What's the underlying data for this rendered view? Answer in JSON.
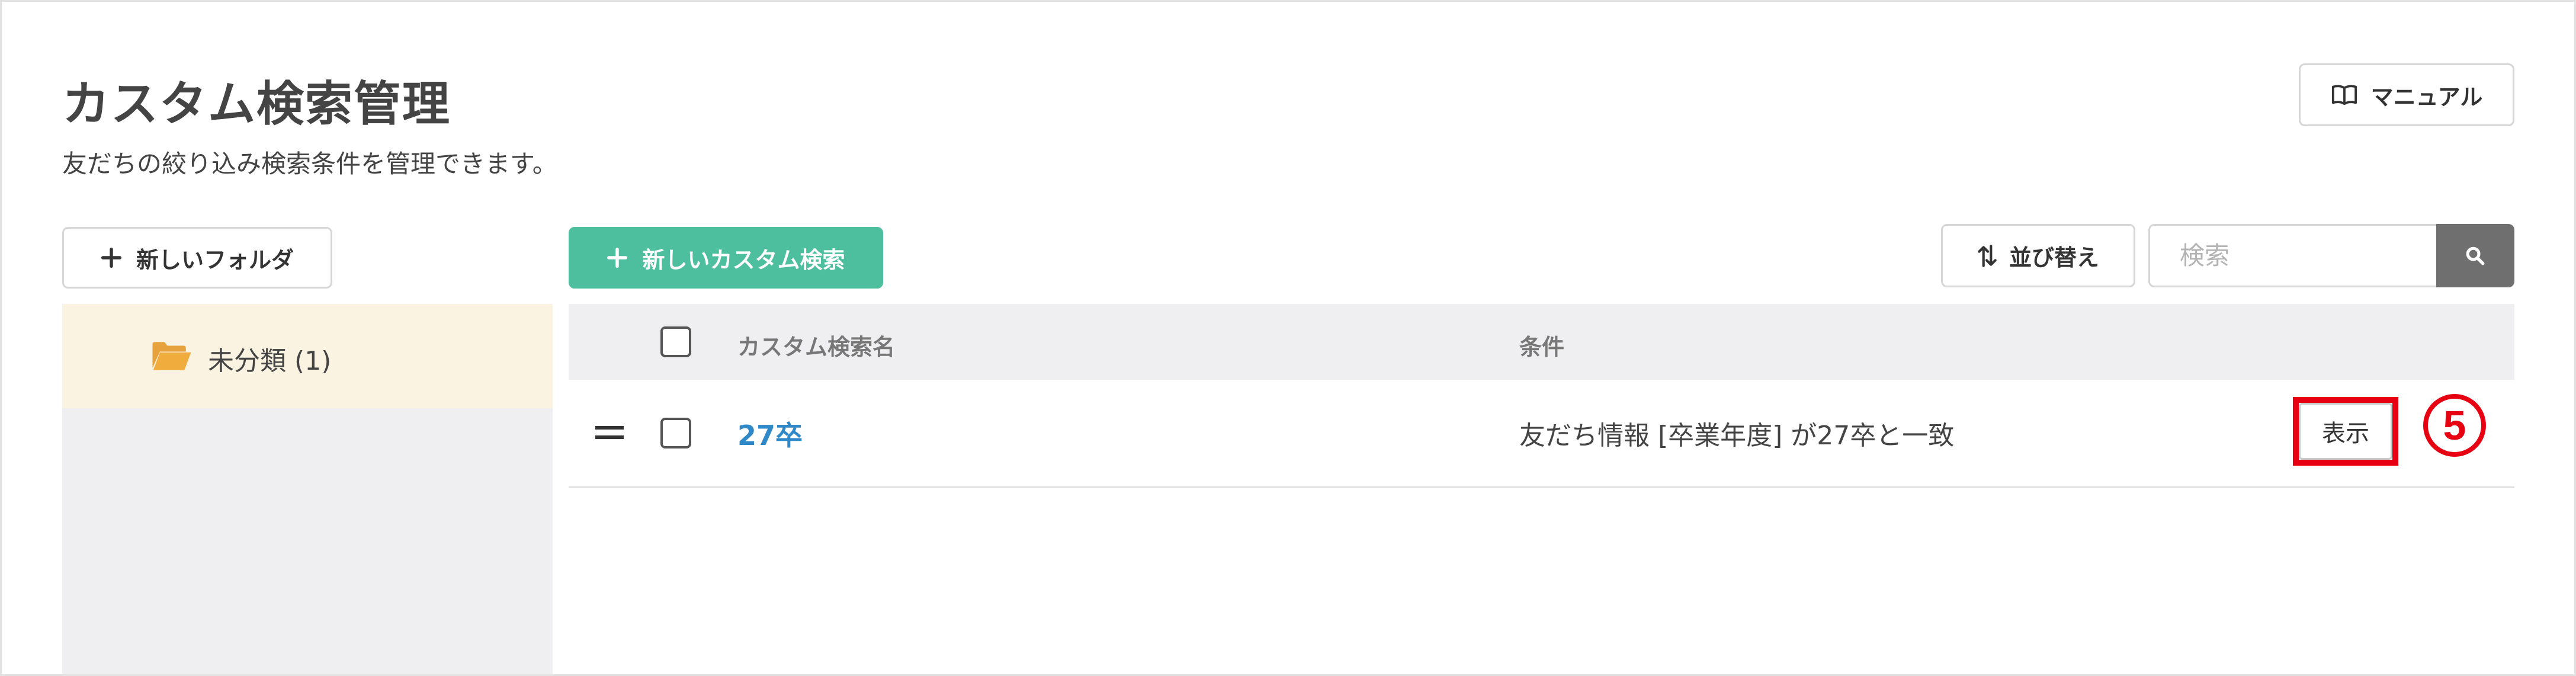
{
  "header": {
    "title": "カスタム検索管理",
    "subtitle": "友だちの絞り込み検索条件を管理できます。",
    "manual_label": "マニュアル",
    "manual_icon": "book-icon"
  },
  "toolbar": {
    "new_folder_label": "新しいフォルダ",
    "new_custom_search_label": "新しいカスタム検索",
    "sort_label": "並び替え",
    "search_placeholder": "検索",
    "accent_color": "#4dbf9e"
  },
  "sidebar": {
    "folders": [
      {
        "label": "未分類 (1)",
        "icon": "folder-open-icon",
        "selected": true
      }
    ]
  },
  "table": {
    "columns": [
      "カスタム検索名",
      "条件"
    ],
    "rows": [
      {
        "name": "27卒",
        "condition": "友だち情報 [卒業年度] が27卒と一致",
        "action_label": "表示"
      }
    ]
  },
  "annotation": {
    "step_number": "5",
    "color": "#e60012"
  }
}
